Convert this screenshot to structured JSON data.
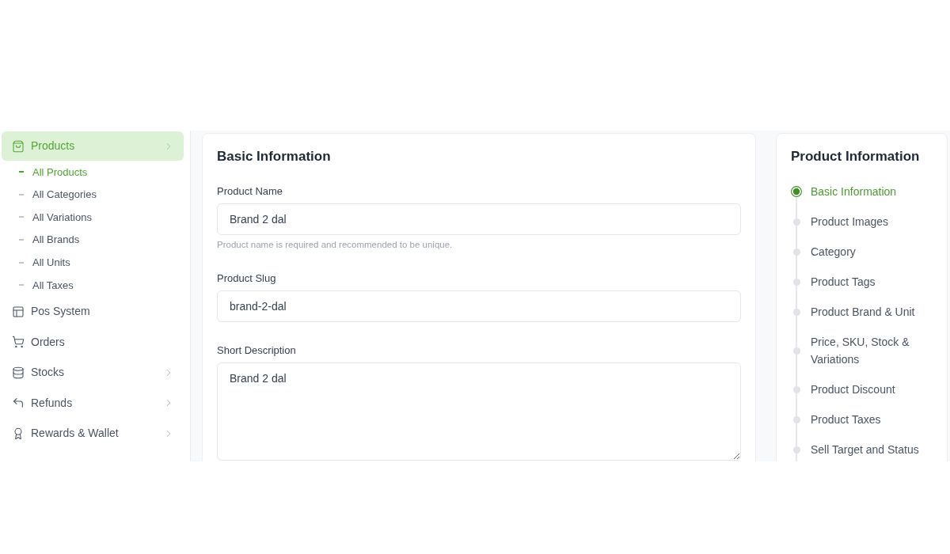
{
  "sidebar": {
    "items": [
      {
        "kind": "group",
        "label": "Products",
        "selected": true,
        "expanded": true,
        "children": [
          {
            "label": "All Products",
            "selected": true
          },
          {
            "label": "All Categories",
            "selected": false
          },
          {
            "label": "All Variations",
            "selected": false
          },
          {
            "label": "All Brands",
            "selected": false
          },
          {
            "label": "All Units",
            "selected": false
          },
          {
            "label": "All Taxes",
            "selected": false
          }
        ]
      },
      {
        "kind": "link",
        "label": "Pos System",
        "selected": false
      },
      {
        "kind": "link",
        "label": "Orders",
        "selected": false
      },
      {
        "kind": "group",
        "label": "Stocks",
        "selected": false,
        "expanded": false
      },
      {
        "kind": "group",
        "label": "Refunds",
        "selected": false,
        "expanded": false
      },
      {
        "kind": "group",
        "label": "Rewards & Wallet",
        "selected": false,
        "expanded": false
      }
    ]
  },
  "basic_information": {
    "title": "Basic Information",
    "fields": [
      {
        "kind": "input",
        "label": "Product Name",
        "value": "Brand 2 dal",
        "help": "Product name is required and recommended to be unique."
      },
      {
        "kind": "input",
        "label": "Product Slug",
        "value": "brand-2-dal"
      },
      {
        "kind": "textarea",
        "label": "Short Description",
        "value": "Brand 2 dal"
      }
    ]
  },
  "product_information": {
    "title": "Product Information",
    "steps": [
      {
        "label": "Basic Information",
        "selected": true
      },
      {
        "label": "Product Images",
        "selected": false
      },
      {
        "label": "Category",
        "selected": false
      },
      {
        "label": "Product Tags",
        "selected": false
      },
      {
        "label": "Product Brand & Unit",
        "selected": false
      },
      {
        "label": "Price, SKU, Stock & Variations",
        "selected": false
      },
      {
        "label": "Product Discount",
        "selected": false
      },
      {
        "label": "Product Taxes",
        "selected": false
      },
      {
        "label": "Sell Target and Status",
        "selected": false
      }
    ]
  }
}
